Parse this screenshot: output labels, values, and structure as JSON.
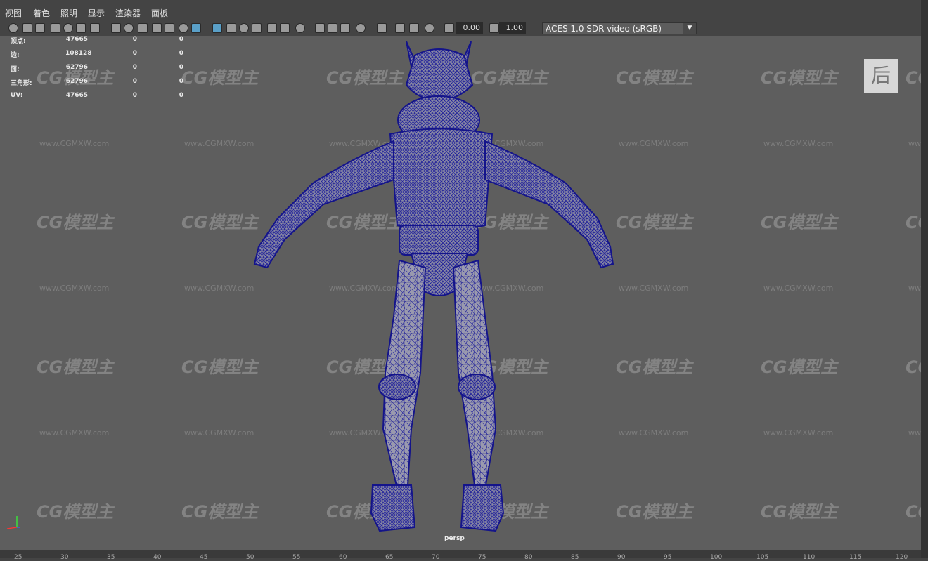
{
  "menu": [
    "视图",
    "着色",
    "照明",
    "显示",
    "渲染器",
    "面板"
  ],
  "toolbar": {
    "exposure_value": "0.00",
    "gamma_value": "1.00",
    "color_space": "ACES 1.0 SDR-video (sRGB)",
    "icons": [
      "camera-icon",
      "camera-attributes-icon",
      "bookmark-icon",
      "image-plane-icon",
      "2d-pan-icon",
      "grease-pencil-icon",
      "grid-icon",
      "film-gate-icon",
      "resolution-gate-icon",
      "gate-mask-icon",
      "field-chart-icon",
      "safe-action-icon",
      "safe-title-icon",
      "wireframe-icon",
      "smooth-shade-icon",
      "default-material-icon",
      "wireframe-on-shaded-icon",
      "textured-icon",
      "lighting-icon",
      "shadows-icon",
      "screen-space-ao-icon",
      "motion-blur-icon",
      "anti-alias-icon",
      "depth-of-field-icon",
      "isolate-select-icon",
      "xray-icon",
      "xray-joints-icon",
      "backface-icon",
      "exposure-icon",
      "gamma-icon",
      "color-management-icon"
    ]
  },
  "hud": {
    "rows": [
      {
        "label": "顶点:",
        "v1": "47665",
        "v2": "0",
        "v3": "0"
      },
      {
        "label": "边:",
        "v1": "108128",
        "v2": "0",
        "v3": "0"
      },
      {
        "label": "面:",
        "v1": "62796",
        "v2": "0",
        "v3": "0"
      },
      {
        "label": "三角形:",
        "v1": "62796",
        "v2": "0",
        "v3": "0"
      },
      {
        "label": "UV:",
        "v1": "47665",
        "v2": "0",
        "v3": "0"
      }
    ]
  },
  "watermark": {
    "logo": "CG模型主",
    "url": "www.CGMXW.com"
  },
  "view_cube": {
    "label": "后"
  },
  "camera_label": "persp",
  "ruler": [
    "25",
    "30",
    "35",
    "40",
    "45",
    "50",
    "55",
    "60",
    "65",
    "70",
    "75",
    "80",
    "85",
    "90",
    "95",
    "100",
    "105",
    "110",
    "115",
    "120"
  ],
  "colors": {
    "wireframe": "#1a1a9c",
    "viewport_bg": "#5e5e5e",
    "mesh_fill": "#8a8aa8"
  }
}
